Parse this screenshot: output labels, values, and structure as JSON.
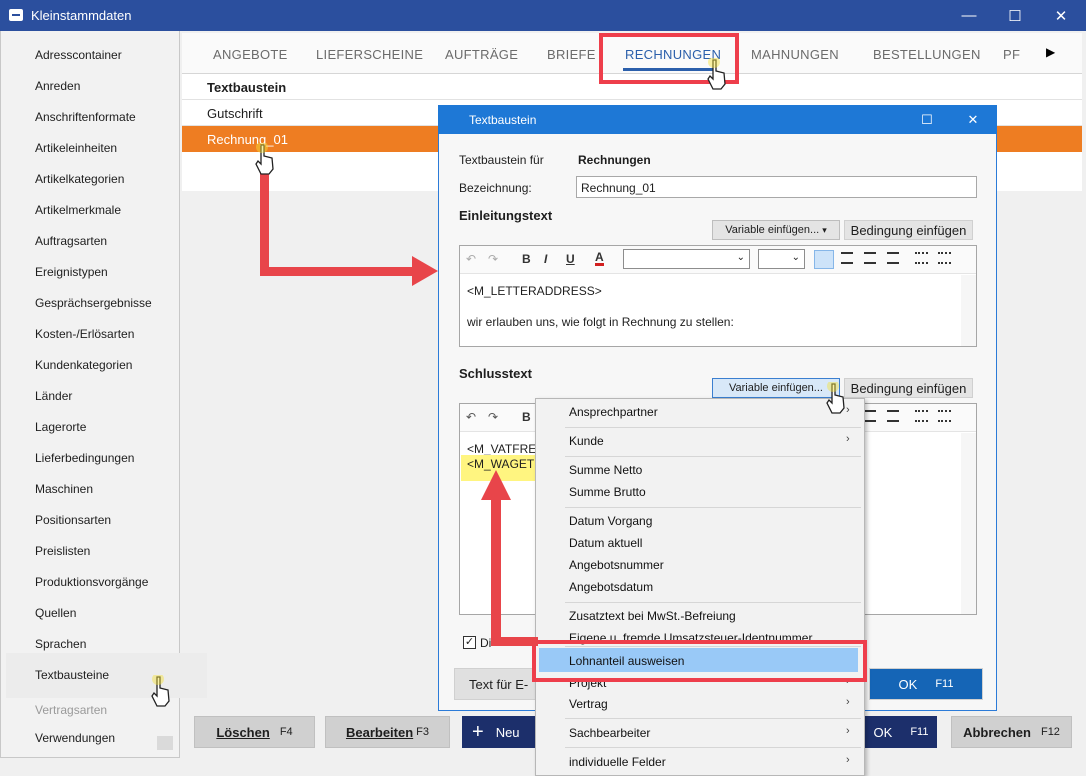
{
  "window": {
    "title": "Kleinstammdaten",
    "minimize": "—",
    "maximize": "☐",
    "close": "✕"
  },
  "sidebar": {
    "items": [
      "Adresscontainer",
      "Anreden",
      "Anschriftenformate",
      "Artikeleinheiten",
      "Artikelkategorien",
      "Artikelmerkmale",
      "Auftragsarten",
      "Ereignistypen",
      "Gesprächsergebnisse",
      "Kosten-/Erlösarten",
      "Kundenkategorien",
      "Länder",
      "Lagerorte",
      "Lieferbedingungen",
      "Maschinen",
      "Positionsarten",
      "Preislisten",
      "Produktionsvorgänge",
      "Quellen",
      "Sprachen",
      "Textbausteine",
      "Vertragsarten",
      "Verwendungen"
    ],
    "selected": "Textbausteine"
  },
  "tabs": {
    "items": [
      "ANGEBOTE",
      "LIEFERSCHEINE",
      "AUFTRÄGE",
      "BRIEFE",
      "RECHNUNGEN",
      "MAHNUNGEN",
      "BESTELLUNGEN",
      "PF"
    ],
    "active": "RECHNUNGEN",
    "scroll_arrow": "▶"
  },
  "list": {
    "header": "Textbaustein",
    "rows": [
      "Gutschrift",
      "Rechnung_01"
    ]
  },
  "bottom_buttons": {
    "delete": "Löschen",
    "delete_key": "F4",
    "edit": "Bearbeiten",
    "edit_key": "F3",
    "new_icon": "+",
    "new": "Neu",
    "ok": "OK",
    "ok_key": "F11",
    "cancel": "Abbrechen",
    "cancel_key": "F12"
  },
  "dialog": {
    "title": "Textbaustein",
    "textbaustein_fuer_label": "Textbaustein für",
    "textbaustein_fuer_value": "Rechnungen",
    "bezeichnung_label": "Bezeichnung:",
    "bezeichnung_value": "Rechnung_01",
    "einleitung_heading": "Einleitungstext",
    "variable_btn": "Variable einfügen...",
    "bedingung_btn": "Bedingung einfügen",
    "einleitung_lines": [
      "<M_LETTERADDRESS>",
      "wir erlauben uns, wie folgt in Rechnung zu stellen:"
    ],
    "schluss_heading": "Schlusstext",
    "schluss_lines": [
      "<M_VATFRE",
      "<M_WAGETI"
    ],
    "checkbox_label": "Di",
    "text_fuer_btn": "Text für E-",
    "ok": "OK",
    "ok_key": "F11",
    "toolbar": {
      "undo": "↶",
      "redo": "↷",
      "bold": "B",
      "italic": "I",
      "underline": "U",
      "fontcolor": "A"
    }
  },
  "menu": {
    "items": [
      {
        "label": "Ansprechpartner",
        "sub": true
      },
      {
        "label": "Kunde",
        "sub": true
      },
      {
        "label": "Summe Netto",
        "sub": false
      },
      {
        "label": "Summe Brutto",
        "sub": false
      },
      {
        "label": "Datum Vorgang",
        "sub": false
      },
      {
        "label": "Datum aktuell",
        "sub": false
      },
      {
        "label": "Angebotsnummer",
        "sub": false
      },
      {
        "label": "Angebotsdatum",
        "sub": false
      },
      {
        "label": "Zusatztext bei MwSt.-Befreiung",
        "sub": false
      },
      {
        "label": "Eigene u. fremde Umsatzsteuer-Identnummer",
        "sub": false
      },
      {
        "label": "Lohnanteil ausweisen",
        "sub": false
      },
      {
        "label": "Projekt",
        "sub": true
      },
      {
        "label": "Vertrag",
        "sub": true
      },
      {
        "label": "Sachbearbeiter",
        "sub": true
      },
      {
        "label": "individuelle Felder",
        "sub": true
      }
    ],
    "highlighted": "Lohnanteil ausweisen",
    "arrow": "›"
  },
  "colors": {
    "titlebar": "#2b4f9e",
    "dialog_title": "#1e78d6",
    "selection": "#ee7d22",
    "accent": "#2b5fab",
    "annotation": "#ee3e4b",
    "menu_highlight": "#99c9f7"
  }
}
